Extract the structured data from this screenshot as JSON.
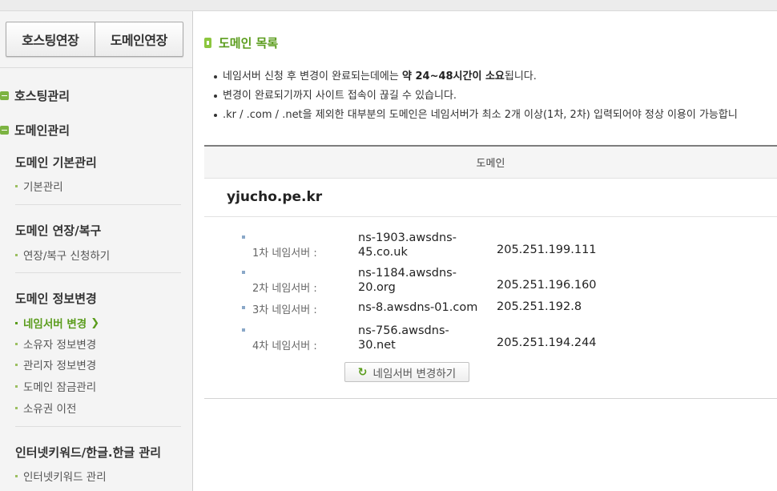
{
  "sidebar": {
    "tabs": {
      "hosting_extend": "호스팅연장",
      "domain_extend": "도메인연장"
    },
    "sections": {
      "hosting_manage": "호스팅관리",
      "domain_manage": "도메인관리"
    },
    "groups": [
      {
        "title": "도메인 기본관리",
        "items": [
          "기본관리"
        ]
      },
      {
        "title": "도메인 연장/복구",
        "items": [
          "연장/복구 신청하기"
        ]
      },
      {
        "title": "도메인 정보변경",
        "items": [
          "네임서버 변경",
          "소유자 정보변경",
          "관리자 정보변경",
          "도메인 잠금관리",
          "소유권 이전"
        ]
      },
      {
        "title": "인터넷키워드/한글.한글 관리",
        "items": [
          "인터넷키워드 관리"
        ]
      }
    ],
    "active_item": "네임서버 변경"
  },
  "main": {
    "title": "도메인 목록",
    "notes": {
      "n1_pre": "네임서버 신청 후 변경이 완료되는데에는 ",
      "n1_bold": "약 24~48시간이 소요",
      "n1_post": "됩니다.",
      "n2": "변경이 완료되기까지 사이트 접속이 끊길 수 있습니다.",
      "n3": ".kr / .com / .net을 제외한 대부분의 도메인은 네임서버가 최소 2개 이상(1차, 2차) 입력되어야 정상 이용이 가능합니"
    },
    "table_header": "도메인",
    "domain": "yjucho.pe.kr",
    "nameservers": [
      {
        "label": "1차 네임서버 :",
        "host_line1": "ns-1903.awsdns-",
        "host_line2": "45.co.uk",
        "ip": "205.251.199.111"
      },
      {
        "label": "2차 네임서버 :",
        "host_line1": "ns-1184.awsdns-",
        "host_line2": "20.org",
        "ip": "205.251.196.160"
      },
      {
        "label": "3차 네임서버 :",
        "host_line1": "ns-8.awsdns-01.com",
        "host_line2": "",
        "ip": "205.251.192.8"
      },
      {
        "label": "4차 네임서버 :",
        "host_line1": "ns-756.awsdns-",
        "host_line2": "30.net",
        "ip": "205.251.194.244"
      }
    ],
    "change_button": "네임서버 변경하기"
  }
}
